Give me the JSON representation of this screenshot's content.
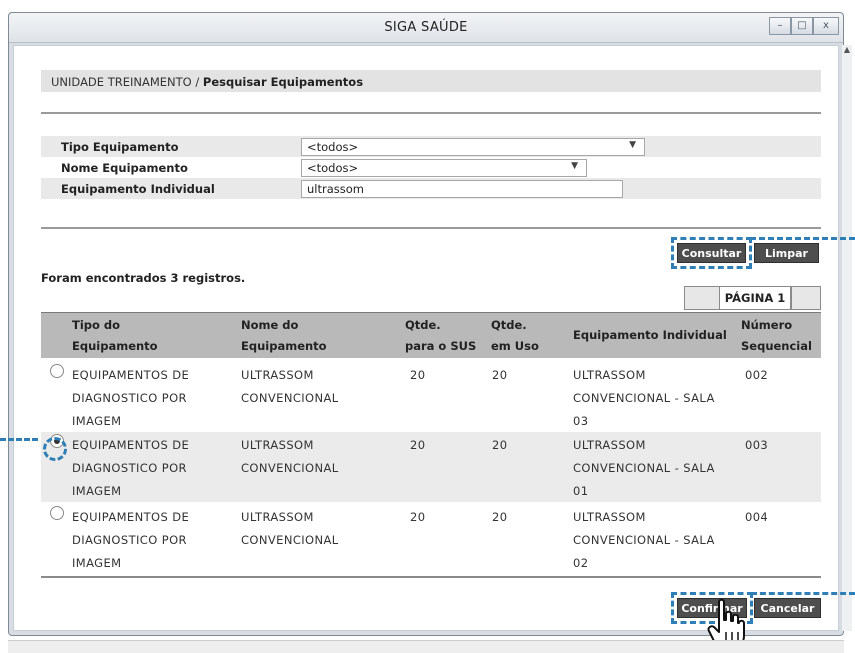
{
  "window": {
    "title": "SIGA SAÚDE",
    "buttons": {
      "minimize": "–",
      "maximize": "□",
      "close": "x"
    }
  },
  "breadcrumb": {
    "unit": "UNIDADE TREINAMENTO /",
    "page": "Pesquisar Equipamentos"
  },
  "form": {
    "tipo_label": "Tipo Equipamento",
    "tipo_value": "<todos>",
    "nome_label": "Nome Equipamento",
    "nome_value": "<todos>",
    "individual_label": "Equipamento Individual",
    "individual_value": "ultrassom"
  },
  "actions": {
    "consultar": "Consultar",
    "limpar": "Limpar",
    "confirmar": "Confirmar",
    "cancelar": "Cancelar"
  },
  "results": {
    "count_text": "Foram encontrados 3 registros.",
    "page_label": "PÁGINA 1"
  },
  "table": {
    "headers": {
      "tipo_1": "Tipo do",
      "tipo_2": "Equipamento",
      "nome_1": "Nome do",
      "nome_2": "Equipamento",
      "sus_1": "Qtde.",
      "sus_2": "para o SUS",
      "uso_1": "Qtde.",
      "uso_2": "em Uso",
      "individual": "Equipamento Individual",
      "seq_1": "Número",
      "seq_2": "Sequencial"
    },
    "rows": [
      {
        "selected": false,
        "tipo": [
          "EQUIPAMENTOS DE",
          "DIAGNOSTICO POR",
          "IMAGEM"
        ],
        "nome": [
          "ULTRASSOM",
          "CONVENCIONAL"
        ],
        "sus": "20",
        "uso": "20",
        "individual": [
          "ULTRASSOM",
          "CONVENCIONAL - SALA",
          "03"
        ],
        "seq": "002"
      },
      {
        "selected": true,
        "tipo": [
          "EQUIPAMENTOS DE",
          "DIAGNOSTICO POR",
          "IMAGEM"
        ],
        "nome": [
          "ULTRASSOM",
          "CONVENCIONAL"
        ],
        "sus": "20",
        "uso": "20",
        "individual": [
          "ULTRASSOM",
          "CONVENCIONAL - SALA",
          "01"
        ],
        "seq": "003"
      },
      {
        "selected": false,
        "tipo": [
          "EQUIPAMENTOS DE",
          "DIAGNOSTICO POR",
          "IMAGEM"
        ],
        "nome": [
          "ULTRASSOM",
          "CONVENCIONAL"
        ],
        "sus": "20",
        "uso": "20",
        "individual": [
          "ULTRASSOM",
          "CONVENCIONAL - SALA",
          "02"
        ],
        "seq": "004"
      }
    ]
  },
  "colors": {
    "highlight": "#2f7fb6",
    "button": "#4e4e4e",
    "header": "#b9b9b9"
  }
}
